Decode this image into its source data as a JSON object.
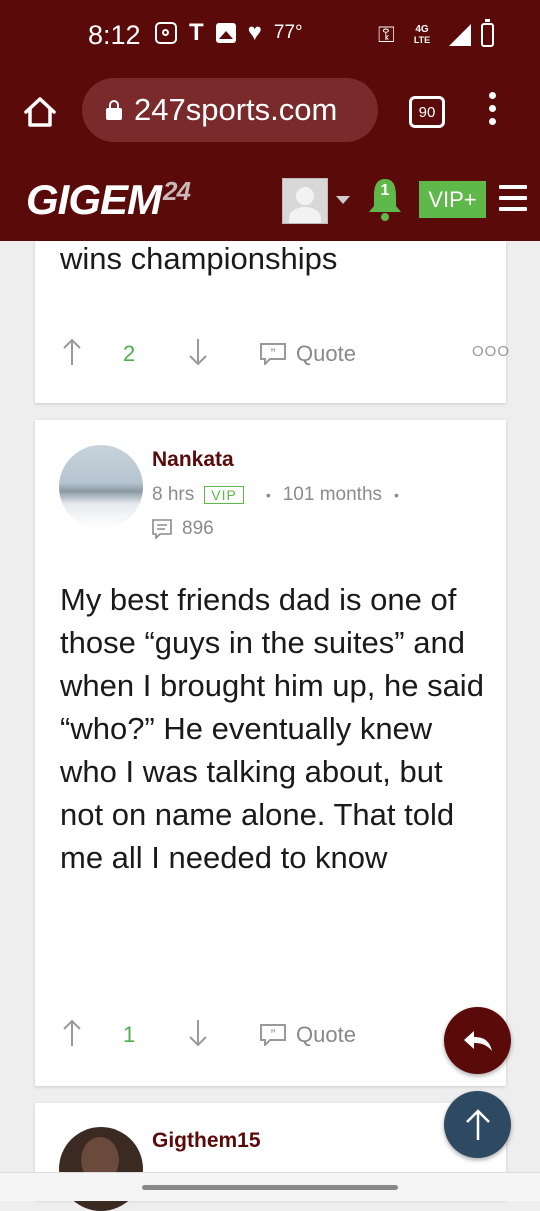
{
  "status_bar": {
    "time": "8:12",
    "temperature": "77°",
    "network": "4G LTE"
  },
  "browser": {
    "url": "247sports.com",
    "tab_count": "90"
  },
  "site": {
    "logo_text": "GIGEM",
    "logo_number": "24",
    "notification_count": "1",
    "vip_label": "VIP+"
  },
  "posts": [
    {
      "text_tail": "wins championships",
      "upvotes": "2",
      "quote_label": "Quote"
    },
    {
      "username": "Nankata",
      "time_ago": "8 hrs",
      "badge": "VIP",
      "tenure": "101 months",
      "post_count": "896",
      "body": "My best friends dad is one of those “guys in the suites” and when I brought him up, he said “who?” He eventually knew who I was talking about, but not on name alone. That told me all I needed to know",
      "upvotes": "1",
      "quote_label": "Quote"
    },
    {
      "username": "Gigthem15"
    }
  ],
  "colors": {
    "brand_maroon": "#5b0a0a",
    "vip_green": "#5fb84a",
    "scroll_top_blue": "#2e4a63"
  }
}
